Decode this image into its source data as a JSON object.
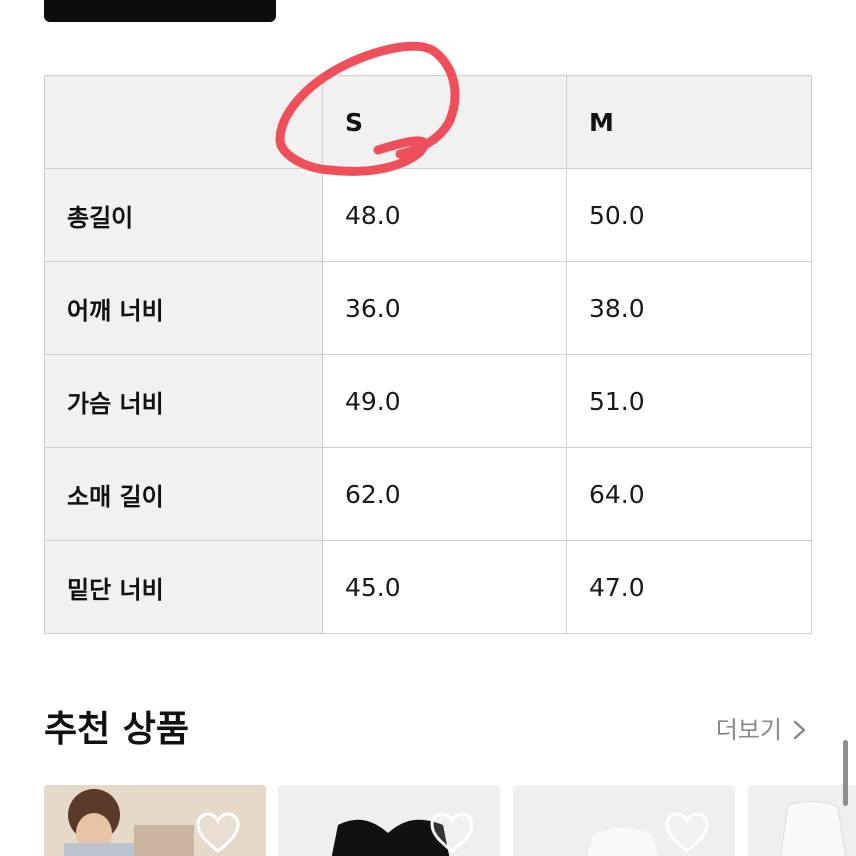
{
  "size_table": {
    "headers": [
      "",
      "S",
      "M"
    ],
    "rows": [
      {
        "label": "총길이",
        "s": "48.0",
        "m": "50.0"
      },
      {
        "label": "어깨 너비",
        "s": "36.0",
        "m": "38.0"
      },
      {
        "label": "가슴 너비",
        "s": "49.0",
        "m": "51.0"
      },
      {
        "label": "소매 길이",
        "s": "62.0",
        "m": "64.0"
      },
      {
        "label": "밑단 너비",
        "s": "45.0",
        "m": "47.0"
      }
    ]
  },
  "recommended": {
    "title": "추천 상품",
    "more_label": "더보기"
  },
  "colors": {
    "annotation": "#ef4f5a",
    "header_bg": "#f1f1f1",
    "border": "#cfcfcf"
  },
  "icons": [
    "heart-icon",
    "chevron-right-icon"
  ]
}
